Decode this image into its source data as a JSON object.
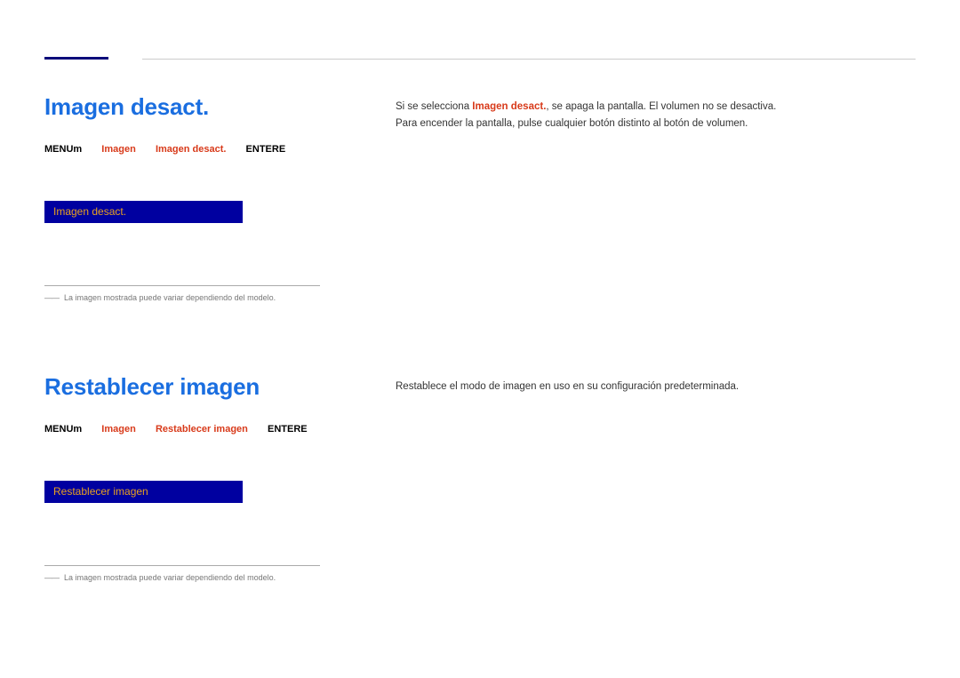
{
  "section1": {
    "heading": "Imagen desact.",
    "breadcrumb": {
      "menu": "MENU",
      "m": "m",
      "part1": "Imagen",
      "part2": "Imagen desact.",
      "enter": "ENTER",
      "e": "E"
    },
    "menu_item": "Imagen desact.",
    "footnote_prefix": "――",
    "footnote": "La imagen mostrada puede variar dependiendo del modelo.",
    "desc_line1_a": "Si se selecciona ",
    "desc_line1_hl": "Imagen desact.",
    "desc_line1_b": ", se apaga la pantalla. El volumen no se desactiva.",
    "desc_line2": "Para encender la pantalla, pulse cualquier botón distinto al botón de volumen."
  },
  "section2": {
    "heading": "Restablecer imagen",
    "breadcrumb": {
      "menu": "MENU",
      "m": "m",
      "part1": "Imagen",
      "part2": "Restablecer imagen",
      "enter": "ENTER",
      "e": "E"
    },
    "menu_item": "Restablecer imagen",
    "footnote_prefix": "――",
    "footnote": "La imagen mostrada puede variar dependiendo del modelo.",
    "desc": "Restablece el modo de imagen en uso en su configuración predeterminada."
  }
}
